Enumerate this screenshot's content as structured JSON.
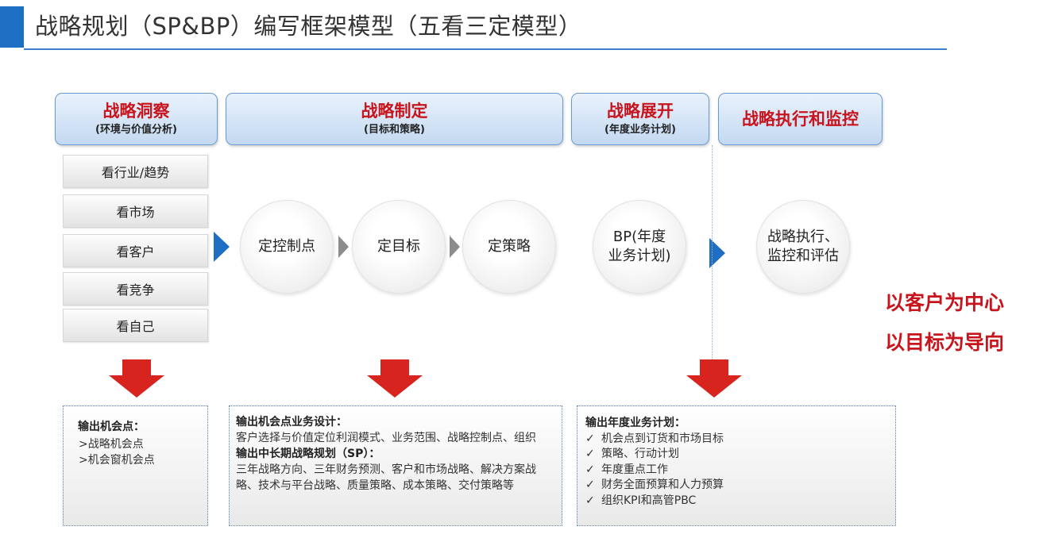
{
  "header": {
    "title": "战略规划（SP&BP）编写框架模型（五看三定模型）"
  },
  "stages": [
    {
      "title": "战略洞察",
      "subtitle": "(环境与价值分析)"
    },
    {
      "title": "战略制定",
      "subtitle": "(目标和策略)"
    },
    {
      "title": "战略展开",
      "subtitle": "(年度业务计划)"
    },
    {
      "title": "战略执行和监控",
      "subtitle": ""
    }
  ],
  "five_looks": [
    "看行业/趋势",
    "看市场",
    "看客户",
    "看竞争",
    "看自己"
  ],
  "circles": [
    "定控制点",
    "定目标",
    "定策略",
    "BP(年度\n业务计划)",
    "战略执行、\n监控和评估"
  ],
  "slogans": [
    "以客户为中心",
    "以目标为导向"
  ],
  "outputs": {
    "insight": {
      "heading": "输出机会点：",
      "items": [
        ">战略机会点",
        ">机会窗机会点"
      ]
    },
    "strategy": {
      "heading1": "输出机会点业务设计：",
      "text1": "客户选择与价值定位利润模式、业务范围、战略控制点、组织",
      "heading2": "输出中长期战略规划（SP）：",
      "text2": "三年战略方向、三年财务预测、客户和市场战略、解决方案战略、技术与平台战略、质量策略、成本策略、交付策略等"
    },
    "annual": {
      "heading": "输出年度业务计划：",
      "check": "✓",
      "items": [
        "机会点到订货和市场目标",
        "策略、行动计划",
        "年度重点工作",
        "财务全面预算和人力预算",
        "组织KPI和高管PBC"
      ]
    }
  },
  "colors": {
    "accent_blue": "#1e6fc4",
    "stage_title_red": "#c8141c",
    "arrow_red": "#d8241f",
    "chevron_gray": "#8c8c8c"
  }
}
